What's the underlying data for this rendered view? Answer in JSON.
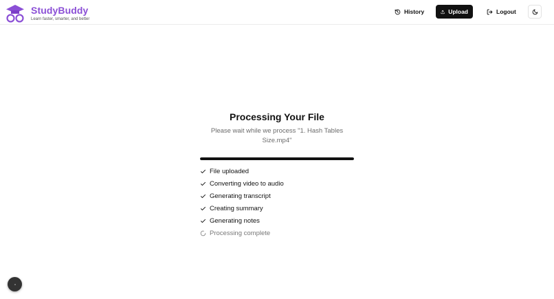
{
  "brand": {
    "name": "StudyBuddy",
    "tagline": "Learn faster, smarter, and better",
    "color": "#8b4fd6"
  },
  "nav": {
    "history_label": "History",
    "upload_label": "Upload",
    "logout_label": "Logout",
    "theme_icon": "moon-icon"
  },
  "processing": {
    "title": "Processing Your File",
    "subtitle": "Please wait while we process \"1. Hash Tables Size.mp4\"",
    "progress": 1.0
  },
  "steps": [
    {
      "label": "File uploaded",
      "status": "done"
    },
    {
      "label": "Converting video to audio",
      "status": "done"
    },
    {
      "label": "Generating transcript",
      "status": "done"
    },
    {
      "label": "Creating summary",
      "status": "done"
    },
    {
      "label": "Generating notes",
      "status": "done"
    },
    {
      "label": "Processing complete",
      "status": "pending"
    }
  ]
}
